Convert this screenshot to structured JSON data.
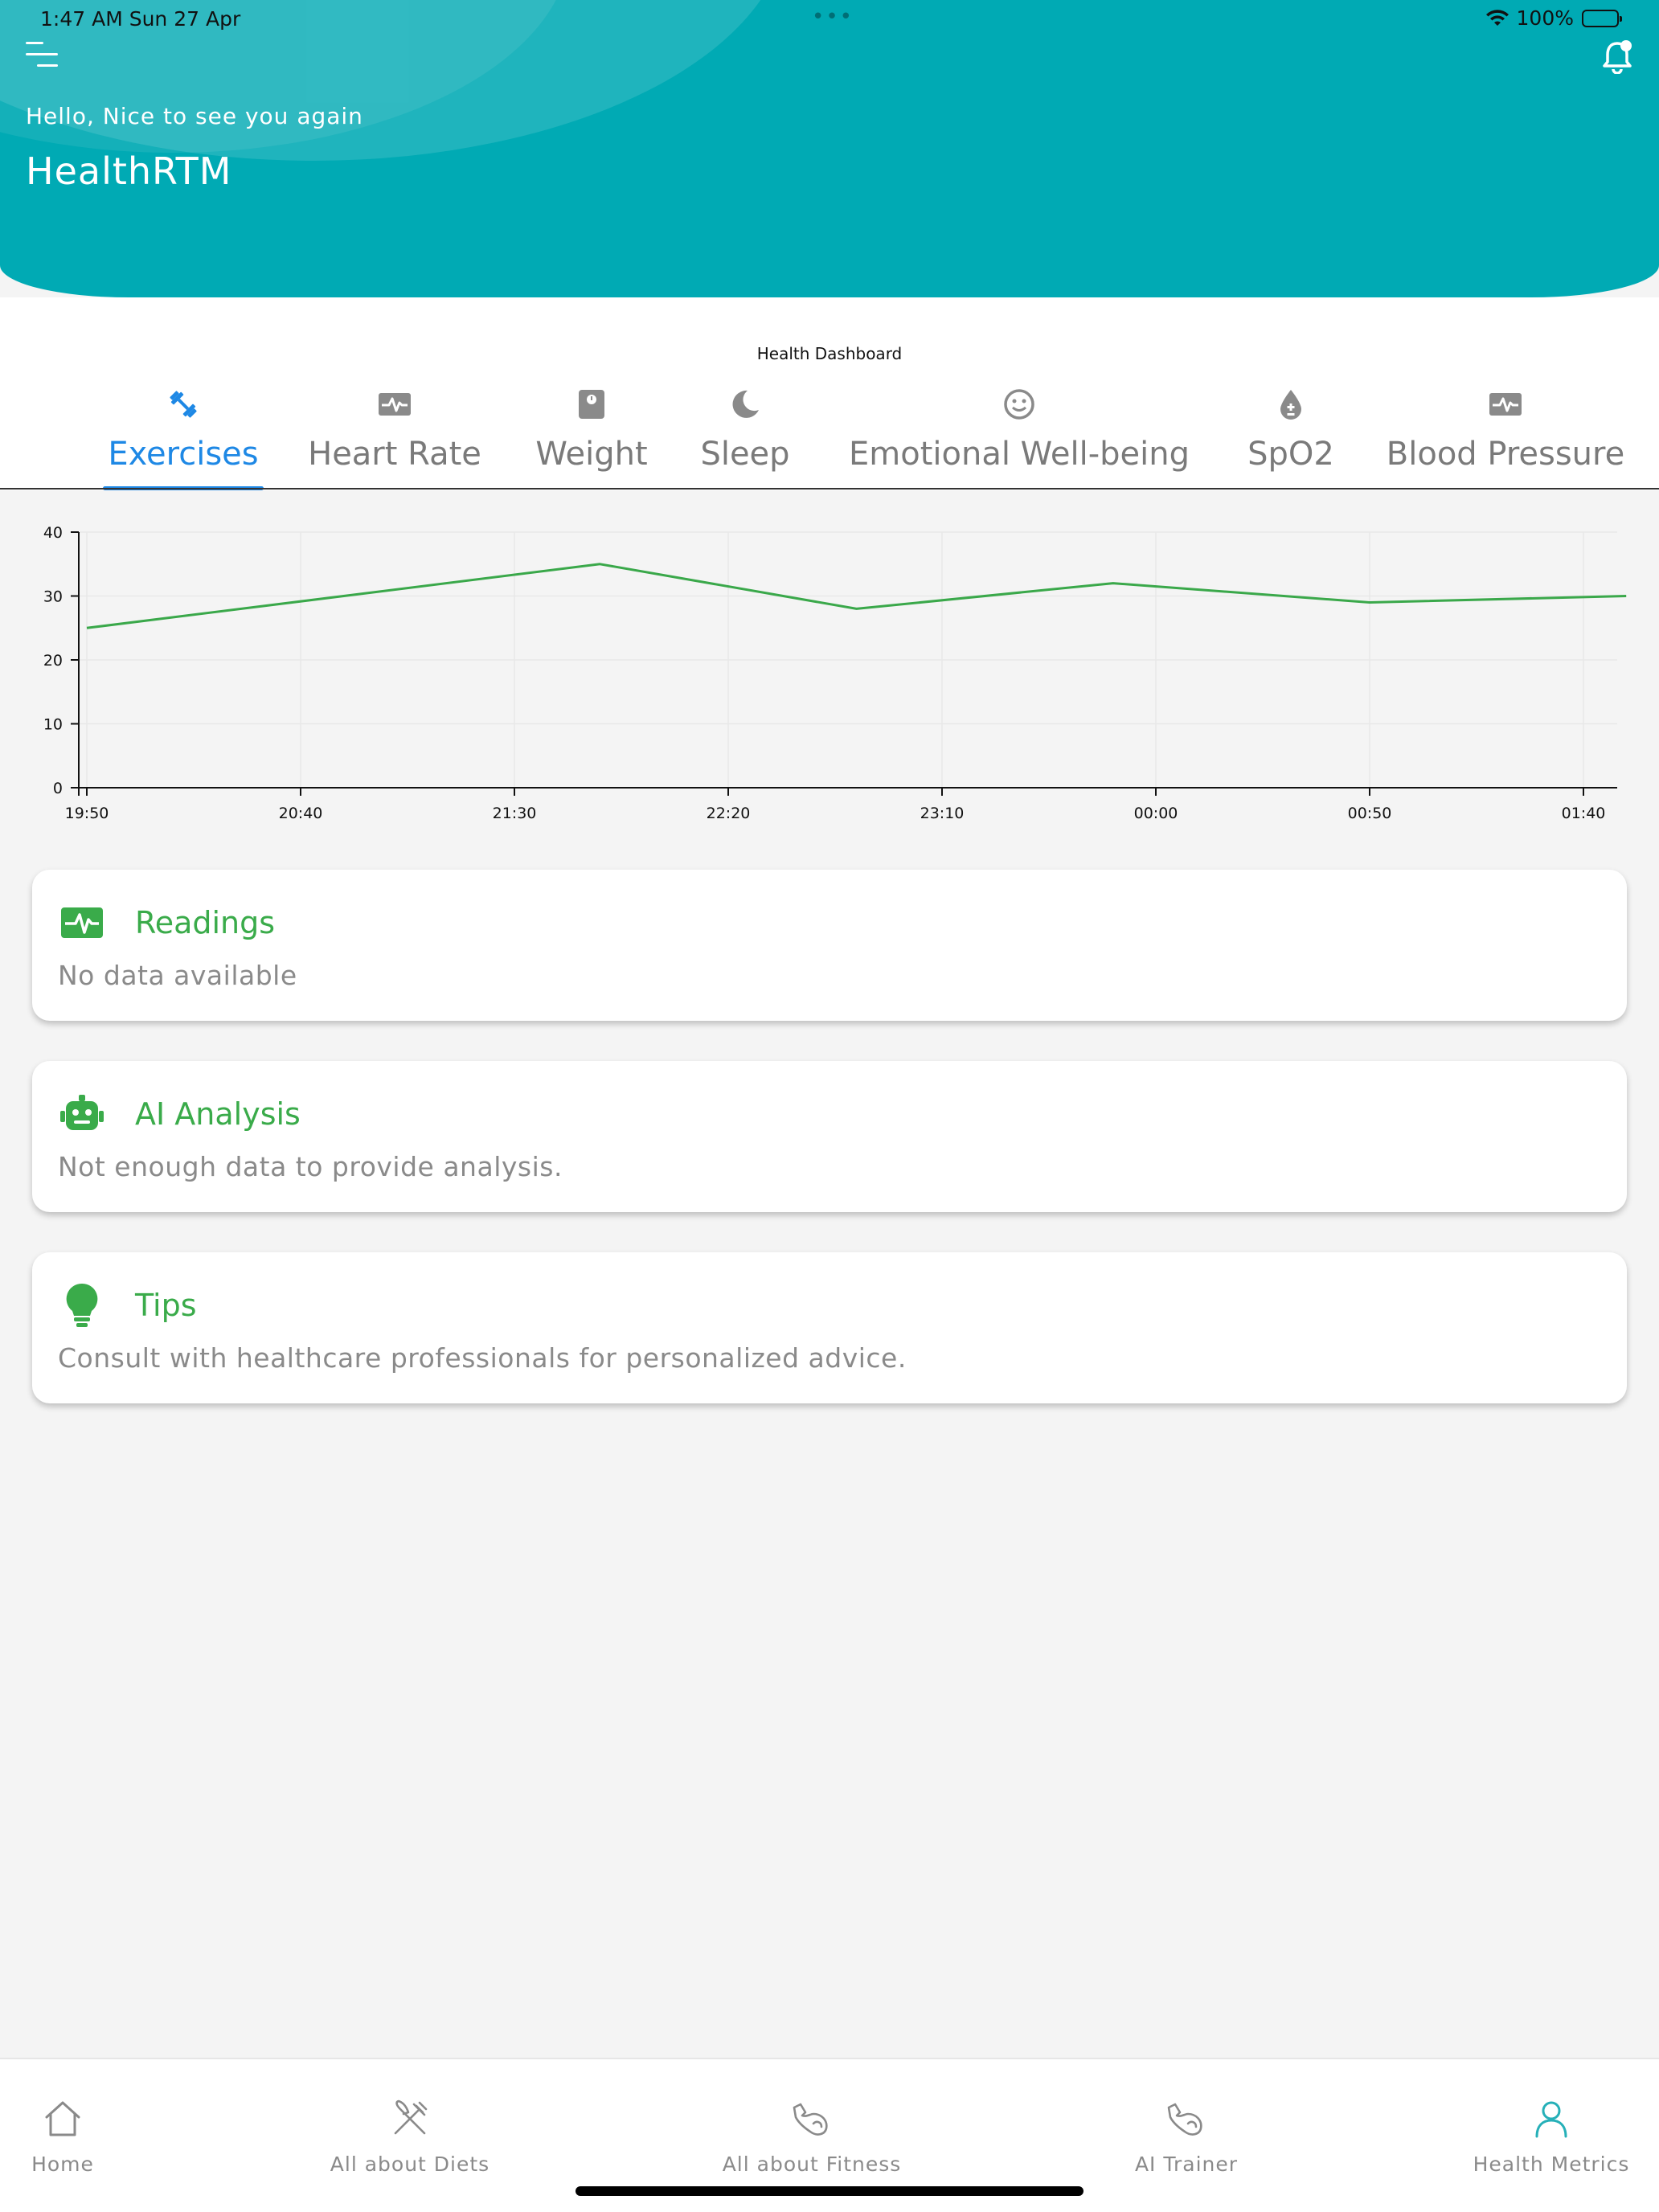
{
  "status_bar": {
    "time": "1:47 AM   Sun 27 Apr",
    "dots": "•••",
    "battery": "100%"
  },
  "header": {
    "greeting": "Hello, Nice to see you again",
    "app_title": "HealthRTM"
  },
  "dashboard": {
    "title": "Health Dashboard"
  },
  "tabs": [
    {
      "label": "Exercises",
      "icon": "dumbbell-icon",
      "active": true
    },
    {
      "label": "Heart Rate",
      "icon": "monitor-heart-icon",
      "active": false
    },
    {
      "label": "Weight",
      "icon": "scale-icon",
      "active": false
    },
    {
      "label": "Sleep",
      "icon": "moon-icon",
      "active": false
    },
    {
      "label": "Emotional Well-being",
      "icon": "smiley-icon",
      "active": false
    },
    {
      "label": "SpO2",
      "icon": "blood-drop-icon",
      "active": false
    },
    {
      "label": "Blood Pressure",
      "icon": "monitor-heart-icon",
      "active": false
    }
  ],
  "chart_data": {
    "type": "line",
    "x": [
      "19:50",
      "20:40",
      "21:30",
      "22:20",
      "23:10",
      "00:00",
      "00:50",
      "01:40"
    ],
    "xlabel": "",
    "ylabel": "",
    "ylim": [
      0,
      40
    ],
    "yticks": [
      0,
      10,
      20,
      30,
      40
    ],
    "grid": true,
    "series": [
      {
        "color": "#3aa84a",
        "points": [
          {
            "t": "19:50",
            "y": 25
          },
          {
            "t": "21:50",
            "y": 35
          },
          {
            "t": "22:50",
            "y": 28
          },
          {
            "t": "23:50",
            "y": 32
          },
          {
            "t": "00:50",
            "y": 29
          },
          {
            "t": "01:50",
            "y": 30
          }
        ]
      }
    ]
  },
  "cards": {
    "readings": {
      "title": "Readings",
      "body": "No data available",
      "icon": "monitor-heart-icon"
    },
    "ai_analysis": {
      "title": "AI Analysis",
      "body": "Not enough data to provide analysis.",
      "icon": "robot-icon"
    },
    "tips": {
      "title": "Tips",
      "body": "Consult with healthcare professionals for personalized advice.",
      "icon": "lightbulb-icon"
    }
  },
  "bottom_nav": [
    {
      "label": "Home",
      "icon": "home-icon",
      "active": false
    },
    {
      "label": "All about Diets",
      "icon": "fork-knife-icon",
      "active": false
    },
    {
      "label": "All about Fitness",
      "icon": "arm-flex-icon",
      "active": false
    },
    {
      "label": "AI Trainer",
      "icon": "arm-flex-icon",
      "active": false
    },
    {
      "label": "Health Metrics",
      "icon": "person-icon",
      "active": true
    }
  ],
  "colors": {
    "header": "#00aab4",
    "accent_blue": "#1e88e5",
    "green": "#3aab4a",
    "teal": "#26b0b8"
  }
}
